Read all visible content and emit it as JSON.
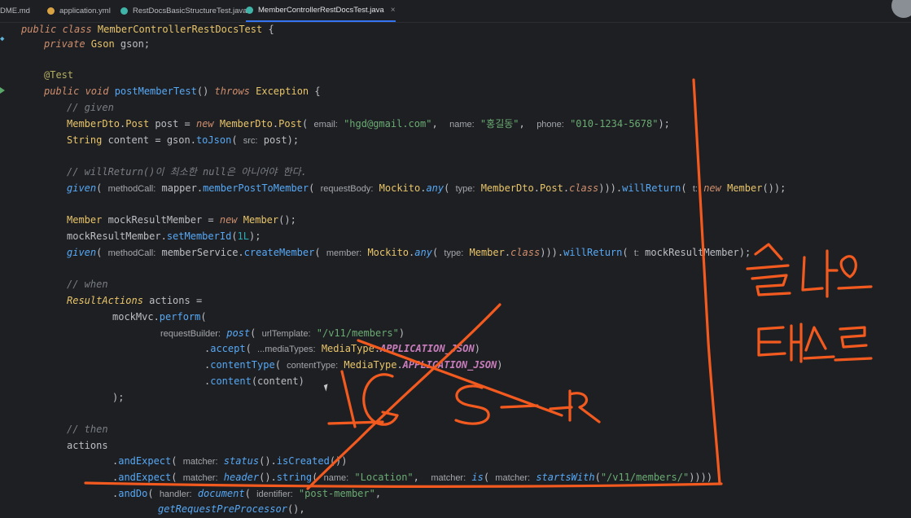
{
  "tabs": [
    {
      "label": "DME.md",
      "icon_color": "#7a7e85",
      "active": false
    },
    {
      "label": "application.yml",
      "icon_color": "#d9a343",
      "active": false
    },
    {
      "label": "RestDocsBasicStructureTest.java",
      "icon_color": "#3fb4a8",
      "active": false
    },
    {
      "label": "MemberControllerRestDocsTest.java",
      "icon_color": "#3fb4a8",
      "active": true,
      "close": "×"
    }
  ],
  "code": {
    "l1": {
      "a": "public class ",
      "b": "MemberControllerRestDocsTest",
      "c": " {"
    },
    "l2": {
      "a": "private ",
      "b": "Gson",
      "c": " gson;"
    },
    "l3": {
      "a": "@Test"
    },
    "l4": {
      "a": "public void ",
      "b": "postMemberTest",
      "c": "() ",
      "d": "throws ",
      "e": "Exception",
      "f": " {"
    },
    "l5": {
      "a": "// given"
    },
    "l6": {
      "a": "MemberDto",
      "b": ".",
      "c": "Post",
      "d": " post = ",
      "e": "new ",
      "f": "MemberDto",
      "g": ".",
      "h": "Post",
      "i": "( ",
      "j": "email:",
      "k": " \"hgd@gmail.com\"",
      "l": ",  ",
      "m": "name:",
      "n": " \"홍길동\"",
      "o": ",  ",
      "p": "phone:",
      "q": " \"010-1234-5678\"",
      "r": ");"
    },
    "l7": {
      "a": "String",
      "b": " content = gson.",
      "c": "toJson",
      "d": "( ",
      "e": "src:",
      "f": " post);"
    },
    "l8": {
      "a": "// willReturn()이 최소한 null은 아니어야 한다."
    },
    "l9": {
      "a": "given",
      "b": "( ",
      "c": "methodCall:",
      "d": " mapper.",
      "e": "memberPostToMember",
      "f": "( ",
      "g": "requestBody:",
      "h": " ",
      "i": "Mockito",
      "j": ".",
      "k": "any",
      "l": "( ",
      "m": "type:",
      "n": " ",
      "o": "MemberDto",
      "p": ".",
      "q": "Post",
      "r": ".",
      "s": "class",
      "t": "))).",
      "u": "willReturn",
      "v": "( ",
      "w": "t:",
      "x": " ",
      "y": "new ",
      "z": "Member",
      "z2": "());"
    },
    "l10": {
      "a": "Member",
      "b": " mockResultMember = ",
      "c": "new ",
      "d": "Member",
      "e": "();"
    },
    "l11": {
      "a": "mockResultMember.",
      "b": "setMemberId",
      "c": "(",
      "d": "1L",
      "e": ");"
    },
    "l12": {
      "a": "given",
      "b": "( ",
      "c": "methodCall:",
      "d": " memberService.",
      "e": "createMember",
      "f": "( ",
      "g": "member:",
      "h": " ",
      "i": "Mockito",
      "j": ".",
      "k": "any",
      "l": "( ",
      "m": "type:",
      "n": " ",
      "o": "Member",
      "p": ".",
      "q": "class",
      "r": "))).",
      "s": "willReturn",
      "t": "( ",
      "u": "t:",
      "v": " mockResultMember);"
    },
    "l13": {
      "a": "// when"
    },
    "l14": {
      "a": "ResultActions",
      "b": " actions ="
    },
    "l15": {
      "a": "mockMvc.",
      "b": "perform",
      "c": "("
    },
    "l16": {
      "a": "requestBuilder:",
      "b": " ",
      "c": "post",
      "d": "( ",
      "e": "urlTemplate:",
      "f": " \"/v11/members\"",
      "g": ")"
    },
    "l17": {
      "a": ".",
      "b": "accept",
      "c": "( ",
      "d": "...mediaTypes:",
      "e": " ",
      "f": "MediaType",
      "g": ".",
      "h": "APPLICATION_JSON",
      "i": ")"
    },
    "l18": {
      "a": ".",
      "b": "contentType",
      "c": "( ",
      "d": "contentType:",
      "e": " ",
      "f": "MediaType",
      "g": ".",
      "h": "APPLICATION_JSON",
      "i": ")"
    },
    "l19": {
      "a": ".",
      "b": "content",
      "c": "(content)"
    },
    "l20": {
      "a": ");"
    },
    "l21": {
      "a": "// then"
    },
    "l22": {
      "a": "actions"
    },
    "l23": {
      "a": ".",
      "b": "andExpect",
      "c": "( ",
      "d": "matcher:",
      "e": " ",
      "f": "status",
      "g": "().",
      "h": "isCreated",
      "i": "())"
    },
    "l24": {
      "a": ".",
      "b": "andExpect",
      "c": "( ",
      "d": "matcher:",
      "e": " ",
      "f": "header",
      "g": "().",
      "h": "string",
      "i": "( ",
      "j": "name:",
      "k": " \"Location\"",
      "l": ",  ",
      "m": "matcher:",
      "n": " ",
      "o": "is",
      "p": "( ",
      "q": "matcher:",
      "r": " ",
      "s": "startsWith",
      "t": "(",
      "u": "\"/v11/members/\"",
      "v": "))))"
    },
    "l25": {
      "a": ".",
      "b": "andDo",
      "c": "( ",
      "d": "handler:",
      "e": " ",
      "f": "document",
      "g": "( ",
      "h": "identifier:",
      "i": " \"post-member\"",
      "j": ","
    },
    "l26": {
      "a": "getRequestPreProcessor",
      "b": "(),"
    }
  },
  "ink_color": "#f25a1f"
}
